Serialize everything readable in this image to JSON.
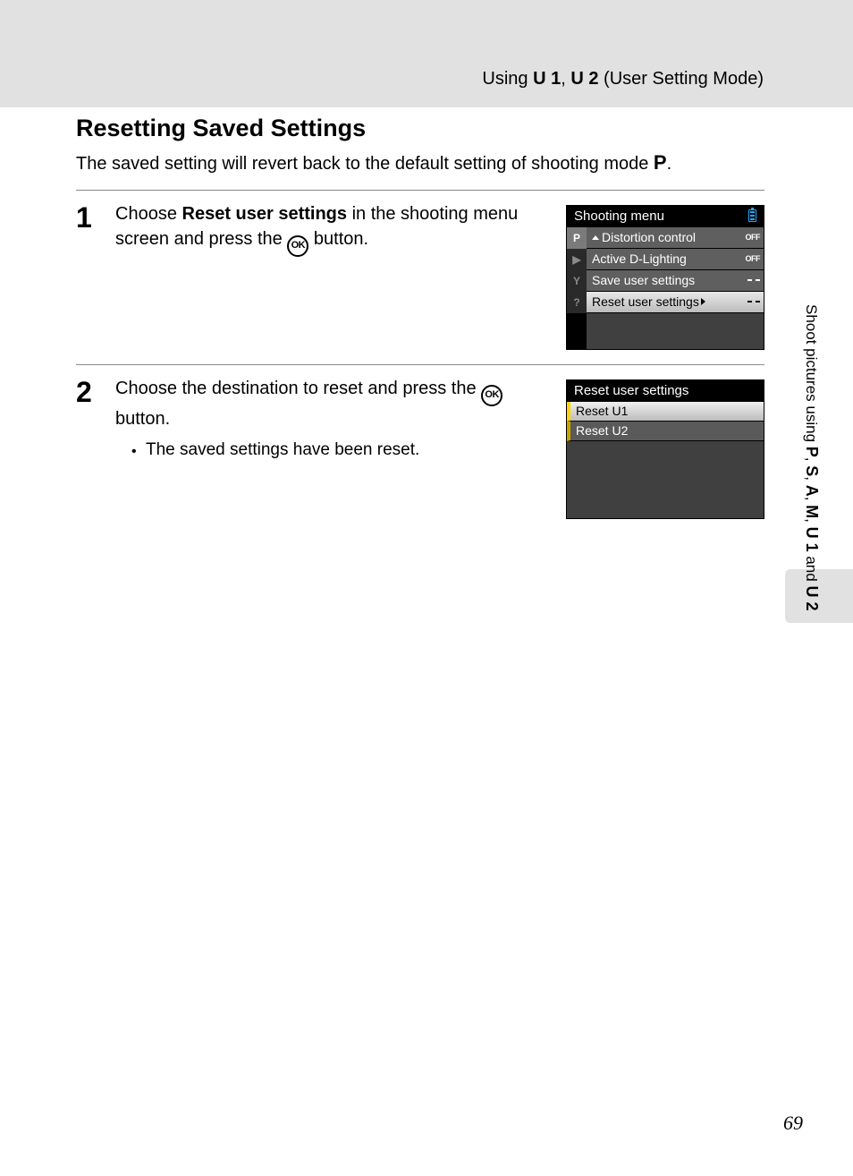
{
  "running_head": {
    "prefix": "Using ",
    "u1": "U 1",
    "sep": ", ",
    "u2": "U 2",
    "suffix": " (User Setting Mode)"
  },
  "title": "Resetting Saved Settings",
  "intro": {
    "part1": "The saved setting will revert back to the default setting of shooting mode ",
    "mode": "P",
    "part2": "."
  },
  "step1": {
    "num": "1",
    "t1": "Choose ",
    "bold": "Reset user settings",
    "t2": " in the shooting menu screen and press the ",
    "ok": "OK",
    "t3": " button."
  },
  "cam1": {
    "title": "Shooting menu",
    "tabs": {
      "p": "P",
      "play": "▶",
      "wrench": "Y",
      "help": "?"
    },
    "rows": {
      "r1": {
        "label": "Distortion control",
        "value": "OFF"
      },
      "r2": {
        "label": "Active D-Lighting",
        "value": "OFF"
      },
      "r3": {
        "label": "Save user settings"
      },
      "r4": {
        "label": "Reset user settings"
      }
    }
  },
  "step2": {
    "num": "2",
    "t1": "Choose the destination to reset and press the ",
    "ok": "OK",
    "t2": " button.",
    "bullet": "The saved settings have been reset."
  },
  "cam2": {
    "title": "Reset user settings",
    "row1": "Reset U1",
    "row2": "Reset U2"
  },
  "side": {
    "t1": "Shoot pictures using ",
    "p": "P",
    "c1": ", ",
    "s": "S",
    "c2": ", ",
    "a": "A",
    "c3": ", ",
    "m": "M",
    "c4": ", ",
    "u1": "U 1",
    "and": " and ",
    "u2": "U 2"
  },
  "page_number": "69"
}
